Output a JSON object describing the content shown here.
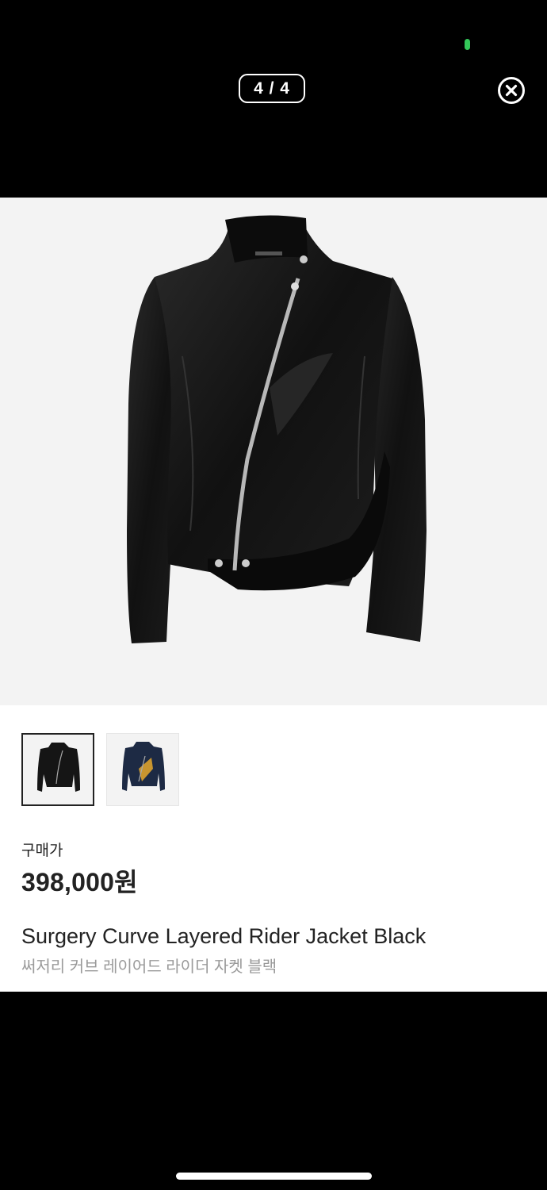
{
  "viewer": {
    "counter": "4 / 4"
  },
  "product": {
    "price_label": "구매가",
    "price": "398,000원",
    "name_en": "Surgery Curve Layered Rider Jacket Black",
    "name_ko": "써저리 커브 레이어드 라이더 자켓 블랙"
  },
  "thumbnails": [
    {
      "name": "black jacket",
      "selected": true
    },
    {
      "name": "navy jacket",
      "selected": false
    }
  ],
  "icons": {
    "close": "close-circle-icon"
  },
  "colors": {
    "status_dot": "#34c759",
    "image_background": "#f3f3f3",
    "text_primary": "#222222",
    "text_secondary": "#9a9a9a"
  }
}
